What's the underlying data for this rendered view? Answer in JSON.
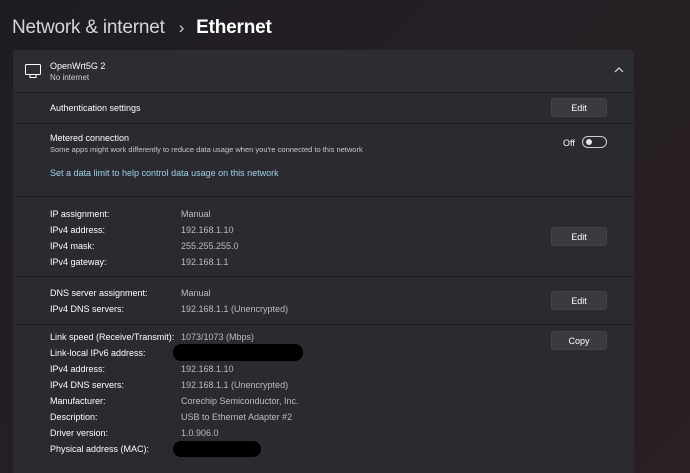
{
  "breadcrumb": {
    "parent": "Network & internet",
    "separator": "›",
    "current": "Ethernet"
  },
  "network": {
    "name": "OpenWrt5G 2",
    "status": "No internet",
    "icon": "ethernet-network-icon"
  },
  "authentication": {
    "label": "Authentication settings",
    "button": "Edit"
  },
  "metered": {
    "label": "Metered connection",
    "description": "Some apps might work differently to reduce data usage when you're connected to this network",
    "toggle_text": "Off",
    "enabled": false,
    "link": "Set a data limit to help control data usage on this network"
  },
  "ip_settings": {
    "button": "Edit",
    "rows": [
      {
        "label": "IP assignment:",
        "value": "Manual"
      },
      {
        "label": "IPv4 address:",
        "value": "192.168.1.10"
      },
      {
        "label": "IPv4 mask:",
        "value": "255.255.255.0"
      },
      {
        "label": "IPv4 gateway:",
        "value": "192.168.1.1"
      }
    ]
  },
  "dns_settings": {
    "button": "Edit",
    "rows": [
      {
        "label": "DNS server assignment:",
        "value": "Manual"
      },
      {
        "label": "IPv4 DNS servers:",
        "value": "192.168.1.1 (Unencrypted)"
      }
    ]
  },
  "properties": {
    "button": "Copy",
    "rows": [
      {
        "label": "Link speed (Receive/Transmit):",
        "value": "1073/1073 (Mbps)"
      },
      {
        "label": "Link-local IPv6 address:",
        "value": ""
      },
      {
        "label": "IPv4 address:",
        "value": "192.168.1.10"
      },
      {
        "label": "IPv4 DNS servers:",
        "value": "192.168.1.1 (Unencrypted)"
      },
      {
        "label": "Manufacturer:",
        "value": "Corechip Semiconductor, Inc."
      },
      {
        "label": "Description:",
        "value": "USB to Ethernet Adapter #2"
      },
      {
        "label": "Driver version:",
        "value": "1.0.906.0"
      },
      {
        "label": "Physical address (MAC):",
        "value": ""
      }
    ]
  },
  "colors": {
    "background": "#241f25",
    "panel": "#2b2a2e",
    "link": "#9fd1ee",
    "value_text": "#bdbdbd"
  }
}
